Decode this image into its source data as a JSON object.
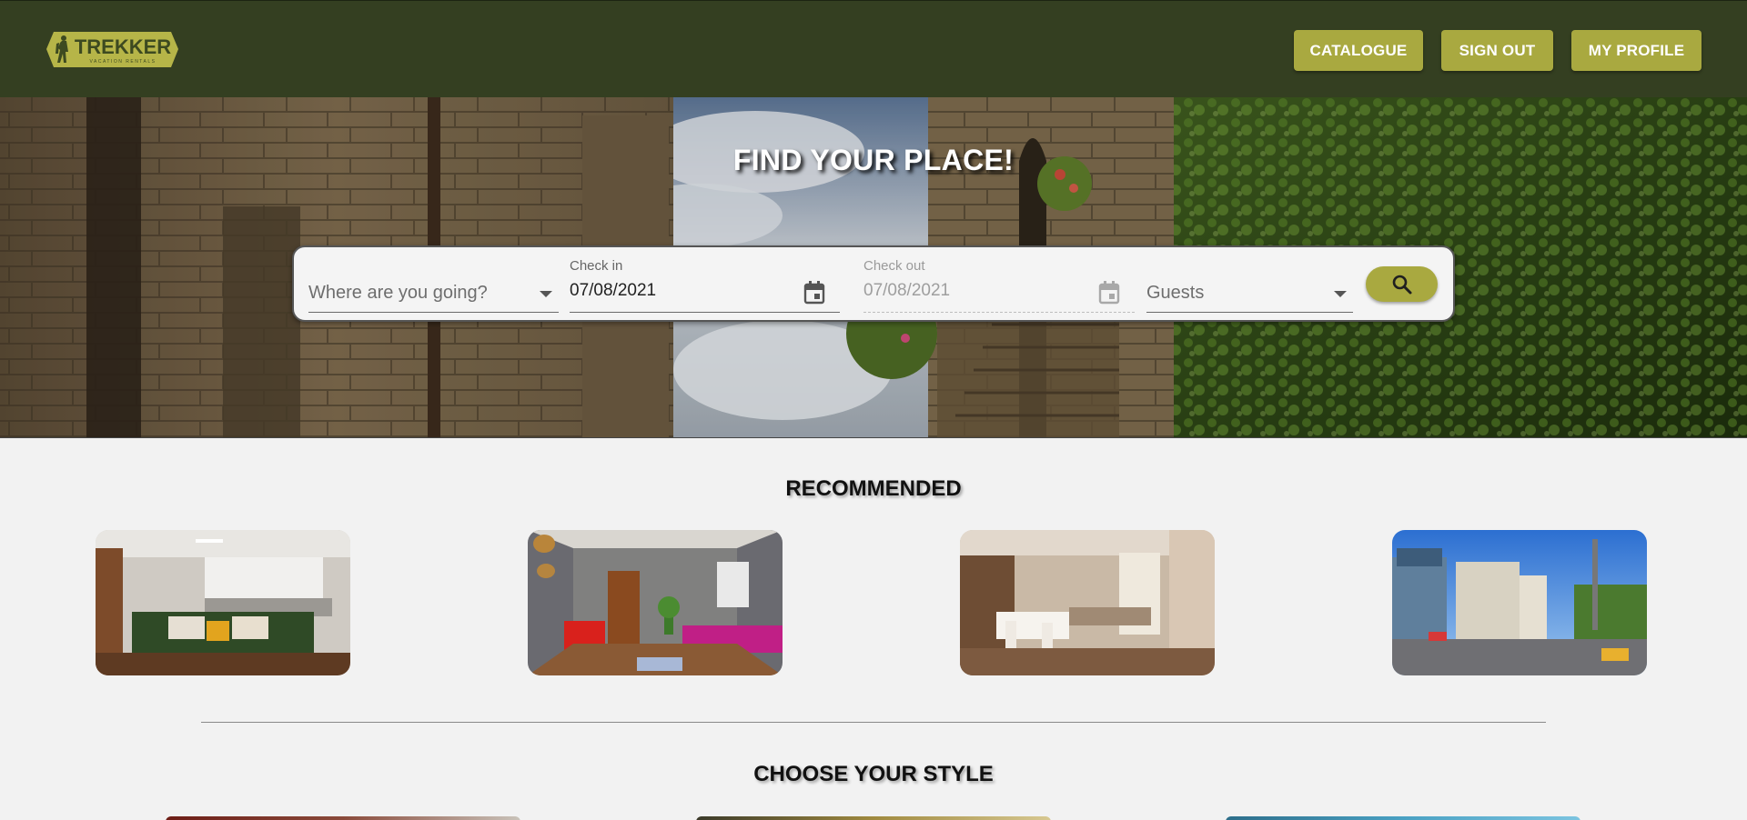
{
  "brand": {
    "name": "TREKKER",
    "tagline": "VACATION RENTALS"
  },
  "nav": {
    "catalogue": "CATALOGUE",
    "sign_out": "SIGN OUT",
    "my_profile": "MY PROFILE"
  },
  "hero": {
    "title": "FIND YOUR PLACE!"
  },
  "search": {
    "destination_placeholder": "Where are you going?",
    "check_in_label": "Check in",
    "check_in_value": "07/08/2021",
    "check_out_label": "Check out",
    "check_out_value": "07/08/2021",
    "guests_placeholder": "Guests"
  },
  "sections": {
    "recommended": "RECOMMENDED",
    "choose_style": "CHOOSE YOUR STYLE"
  },
  "colors": {
    "header": "#343f21",
    "accent": "#a9a940",
    "background": "#f2f2f2"
  },
  "icons": [
    "hiker-logo-icon",
    "calendar-icon",
    "chevron-down-icon",
    "search-icon"
  ]
}
